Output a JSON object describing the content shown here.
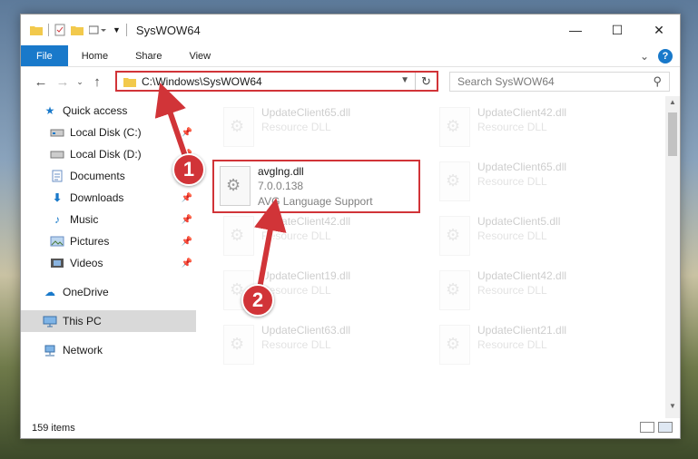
{
  "window": {
    "title": "SysWOW64"
  },
  "ribbon": {
    "tabs": [
      "File",
      "Home",
      "Share",
      "View"
    ]
  },
  "address": {
    "path": "C:\\Windows\\SysWOW64"
  },
  "search": {
    "placeholder": "Search SysWOW64"
  },
  "sidebar": {
    "items": [
      {
        "label": "Quick access",
        "icon": "star-icon"
      },
      {
        "label": "Local Disk (C:)",
        "icon": "drive-icon"
      },
      {
        "label": "Local Disk (D:)",
        "icon": "drive-icon"
      },
      {
        "label": "Documents",
        "icon": "documents-icon"
      },
      {
        "label": "Downloads",
        "icon": "download-icon"
      },
      {
        "label": "Music",
        "icon": "music-icon"
      },
      {
        "label": "Pictures",
        "icon": "pictures-icon"
      },
      {
        "label": "Videos",
        "icon": "videos-icon"
      },
      {
        "label": "OneDrive",
        "icon": "cloud-icon"
      },
      {
        "label": "This PC",
        "icon": "computer-icon"
      },
      {
        "label": "Network",
        "icon": "network-icon"
      }
    ]
  },
  "files": {
    "highlighted": {
      "name": "avglng.dll",
      "version": "7.0.0.138",
      "description": "AVG Language Support"
    },
    "left": [
      {
        "name": "UpdateClient65.dll",
        "type": "Resource DLL"
      },
      {
        "name": "UpdateClient42.dll",
        "type": "Resource DLL"
      },
      {
        "name": "UpdateClient19.dll",
        "type": "Resource DLL"
      },
      {
        "name": "UpdateClient63.dll",
        "type": "Resource DLL"
      }
    ],
    "right": [
      {
        "name": "UpdateClient42.dll",
        "type": "Resource DLL"
      },
      {
        "name": "UpdateClient65.dll",
        "type": "Resource DLL"
      },
      {
        "name": "UpdateClient5.dll",
        "type": "Resource DLL"
      },
      {
        "name": "UpdateClient42.dll",
        "type": "Resource DLL"
      },
      {
        "name": "UpdateClient21.dll",
        "type": "Resource DLL"
      }
    ]
  },
  "status": {
    "count": "159 items"
  },
  "annotations": {
    "step1": "1",
    "step2": "2",
    "color": "#d13438"
  }
}
